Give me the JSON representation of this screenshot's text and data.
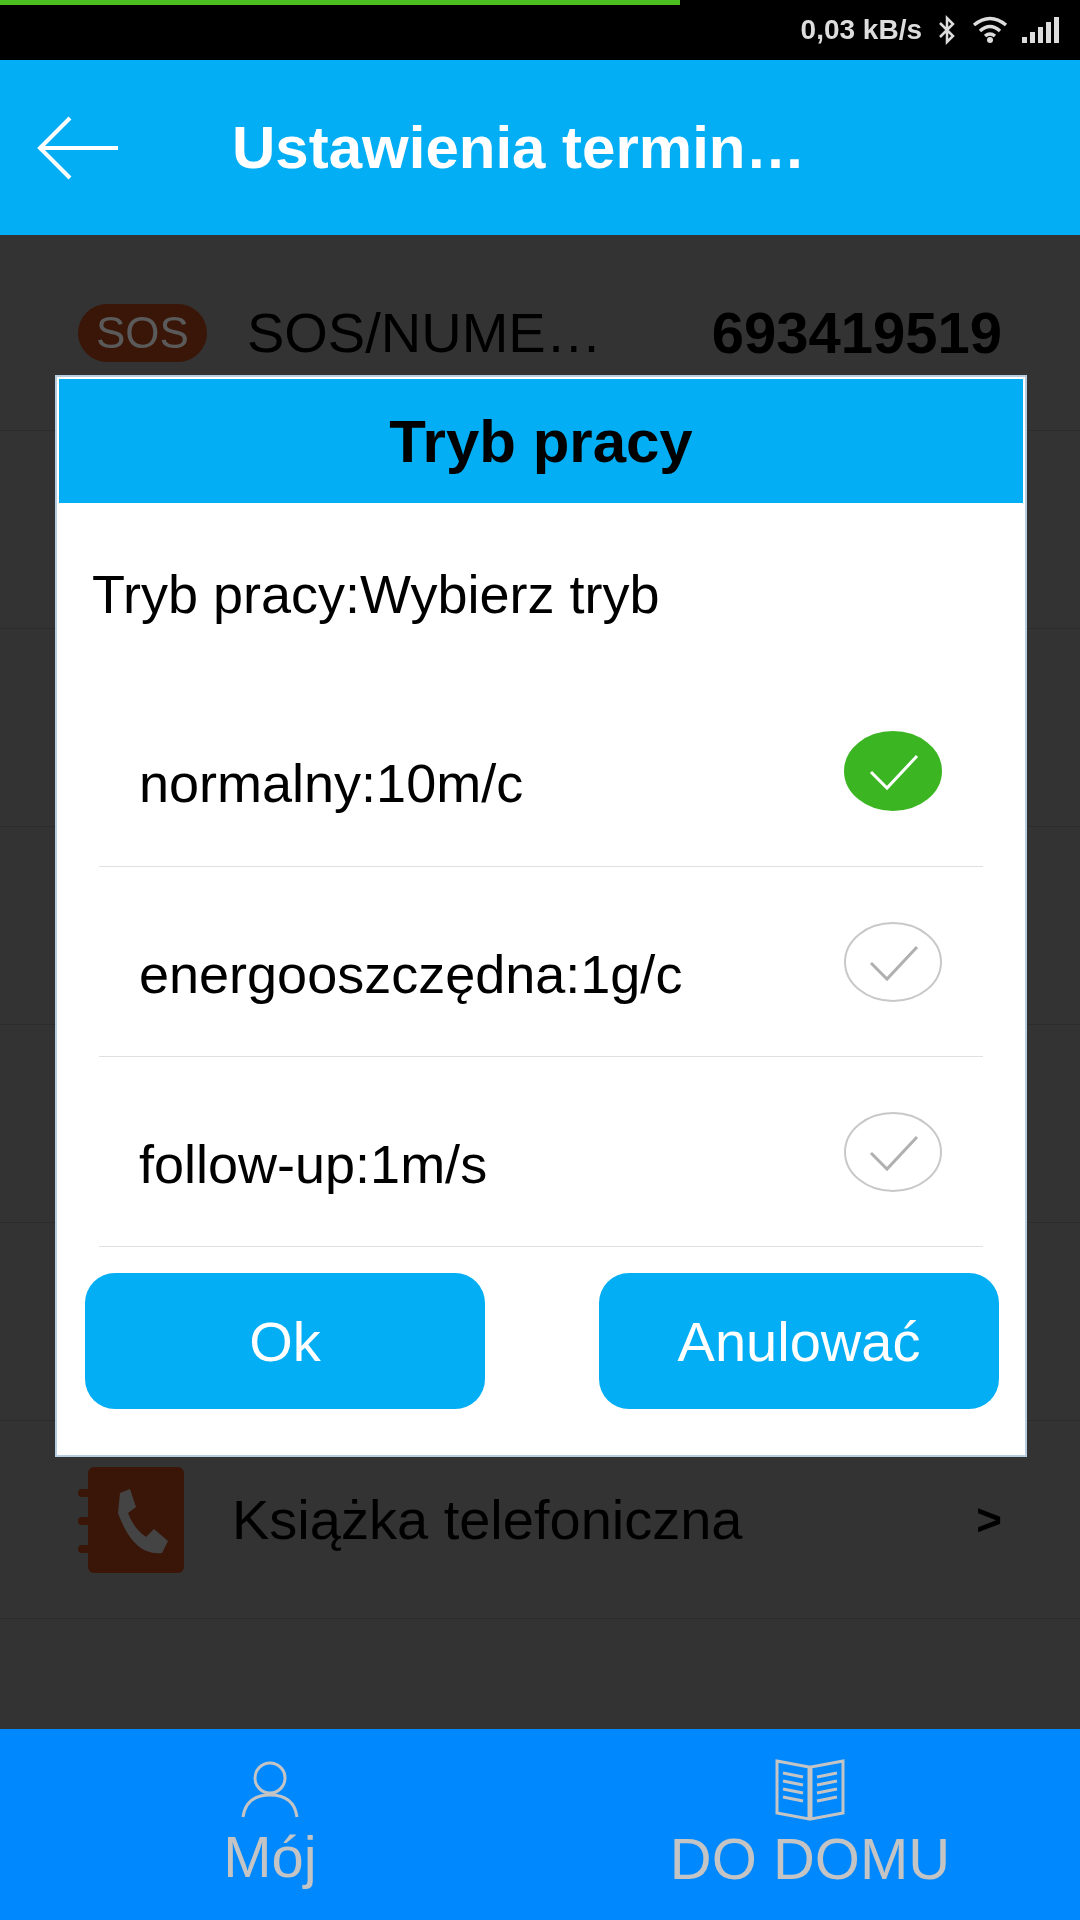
{
  "status_bar": {
    "progress": {
      "level": 0.63
    },
    "speed": "0,03 kB/s"
  },
  "header": {
    "title": "Ustawienia termin…"
  },
  "rows": [
    {
      "kind": "sos",
      "badge": "SOS",
      "label": "SOS/NUME…",
      "value": "693419519"
    },
    {
      "kind": "phonebook",
      "label": "Książka telefoniczna",
      "arrow": ">"
    }
  ],
  "dialog": {
    "title": "Tryb pracy",
    "prompt": "Tryb pracy:Wybierz tryb",
    "options": [
      {
        "label": "normalny:10m/c",
        "selected": true
      },
      {
        "label": "energooszczędna:1g/c",
        "selected": false
      },
      {
        "label": "follow-up:1m/s",
        "selected": false
      }
    ],
    "buttons": [
      "Ok",
      "Anulować"
    ]
  },
  "nav": [
    {
      "kind": "person",
      "label": "Mój"
    },
    {
      "kind": "book",
      "label": "DO DOMU"
    }
  ]
}
